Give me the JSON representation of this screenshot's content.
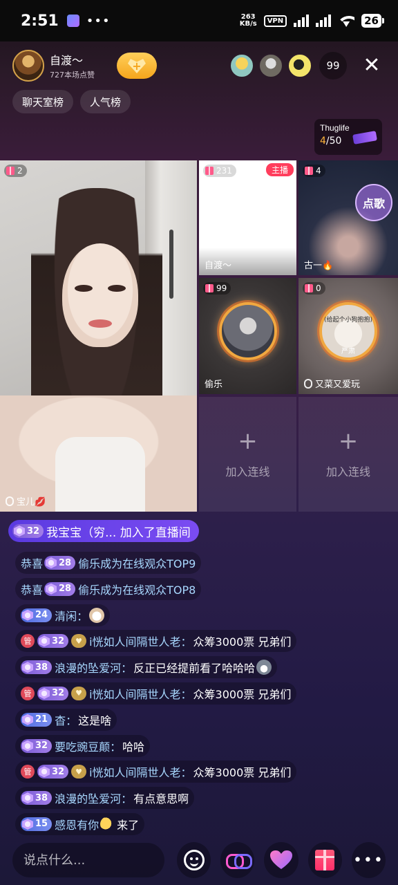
{
  "status_bar": {
    "time": "2:51",
    "dots": "•••",
    "speed_top": "263",
    "speed_bottom": "KB/s",
    "vpn": "VPN",
    "battery": "26"
  },
  "header": {
    "host_name": "自渡～",
    "host_likes": "727本场点赞",
    "follow_icon": "+",
    "viewer_count": "99",
    "close_icon": "✕"
  },
  "rank_tabs": [
    "聊天室榜",
    "人气榜"
  ],
  "thuglife": {
    "title": "Thuglife",
    "current": "4",
    "total": "/50"
  },
  "tiles": {
    "main": {
      "badge": "2",
      "name": "宝儿💋"
    },
    "host": {
      "badge": "231",
      "tag": "主播",
      "name": "自渡～"
    },
    "t2": {
      "badge": "4",
      "song_button": "点歌",
      "name": "古一🔥"
    },
    "t3": {
      "badge": "99",
      "name": "偷乐"
    },
    "t4": {
      "badge": "0",
      "ring_label": "(给起个小狗抱抱)",
      "ring_name": "严肃",
      "name": "又菜又爱玩"
    },
    "empty_plus": "+",
    "empty_label": "加入连线"
  },
  "join_banner": {
    "level": "32",
    "text": "我宝宝（穷... 加入了直播间"
  },
  "chat": [
    {
      "congrats": "恭喜",
      "level": "28",
      "text": "偷乐成为在线观众TOP9"
    },
    {
      "congrats": "恭喜",
      "level": "28",
      "text": "偷乐成为在线观众TOP8"
    },
    {
      "level": "24",
      "user": "清闲：",
      "text": ""
    },
    {
      "mgr": "管",
      "level": "32",
      "user": "i恍如人间隔世人老：",
      "text": "众筹3000票 兄弟们"
    },
    {
      "level": "38",
      "user": "浪漫的坠爱河：",
      "text": "反正已经提前看了哈哈哈"
    },
    {
      "mgr": "管",
      "level": "32",
      "user": "i恍如人间隔世人老：",
      "text": "众筹3000票 兄弟们"
    },
    {
      "level": "21",
      "user": "杳：",
      "text": "这是啥"
    },
    {
      "level": "32",
      "user": "要吃豌豆颠：",
      "text": "哈哈"
    },
    {
      "mgr": "管",
      "level": "32",
      "user": "i恍如人间隔世人老：",
      "text": "众筹3000票 兄弟们"
    },
    {
      "level": "38",
      "user": "浪漫的坠爱河：",
      "text": "有点意思啊"
    },
    {
      "level": "15",
      "user": "感恩有你",
      "text": "来了"
    }
  ],
  "bottom_bar": {
    "input_placeholder": "说点什么...",
    "more": "•••"
  }
}
